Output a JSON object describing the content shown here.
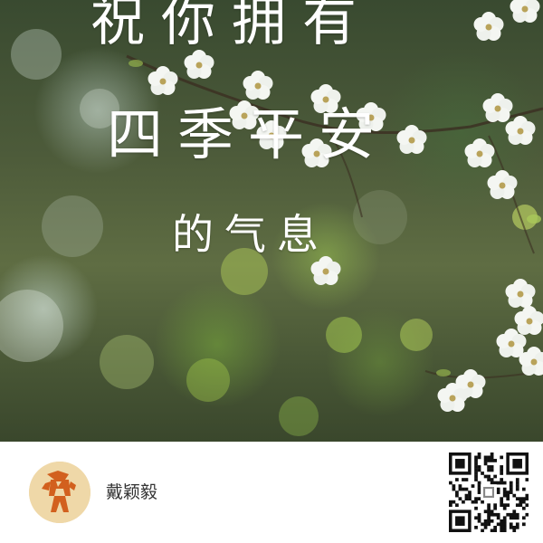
{
  "greeting": {
    "line1": "祝你拥有",
    "line2": "四季平安",
    "line3": "的气息"
  },
  "author": {
    "name": "戴颖毅",
    "avatar_icon": "person-figure-icon"
  },
  "qr_code": {
    "icon": "qr-code-icon"
  },
  "colors": {
    "text_on_photo": "#ffffff",
    "avatar_bg": "#efd8a8",
    "avatar_figure": "#d2601e",
    "author_text": "#333333"
  }
}
